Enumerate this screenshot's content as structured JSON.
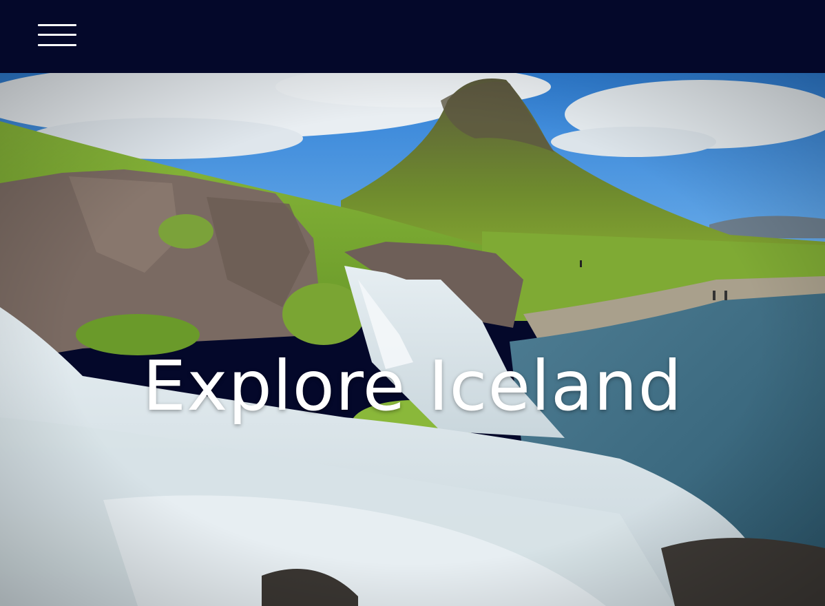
{
  "navbar": {
    "menu_icon": "hamburger-menu-icon",
    "background_color": "#04082a"
  },
  "hero": {
    "title": "Explore Iceland",
    "image_subject": "mountain-waterfall-landscape"
  }
}
